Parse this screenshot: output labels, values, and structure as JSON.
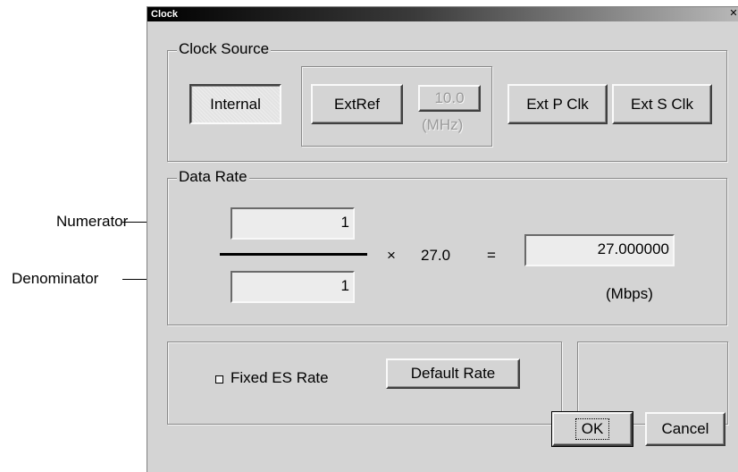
{
  "annotations": {
    "numerator": "Numerator",
    "denominator": "Denominator"
  },
  "window": {
    "title": "Clock",
    "close_glyph": "✕"
  },
  "clock_source": {
    "legend": "Clock Source",
    "internal_label": "Internal",
    "extref_label": "ExtRef",
    "extref_freq_value": "10.0",
    "extref_freq_unit": "(MHz)",
    "ext_p_clk_label": "Ext P Clk",
    "ext_s_clk_label": "Ext S Clk",
    "selected": "Internal"
  },
  "data_rate": {
    "legend": "Data Rate",
    "numerator_value": "1",
    "denominator_value": "1",
    "times_symbol": "×",
    "multiplier": "27.0",
    "equals_symbol": "=",
    "result_value": "27.000000",
    "result_unit": "(Mbps)"
  },
  "es_rate": {
    "fixed_es_rate_label": "Fixed ES Rate",
    "fixed_es_rate_checked": false,
    "default_rate_label": "Default Rate"
  },
  "footer": {
    "ok_label": "OK",
    "cancel_label": "Cancel"
  },
  "colors": {
    "dialog_bg": "#d4d4d4",
    "field_bg": "#ececec",
    "title_gradient_start": "#000000",
    "title_gradient_end": "#b8b8b8"
  }
}
